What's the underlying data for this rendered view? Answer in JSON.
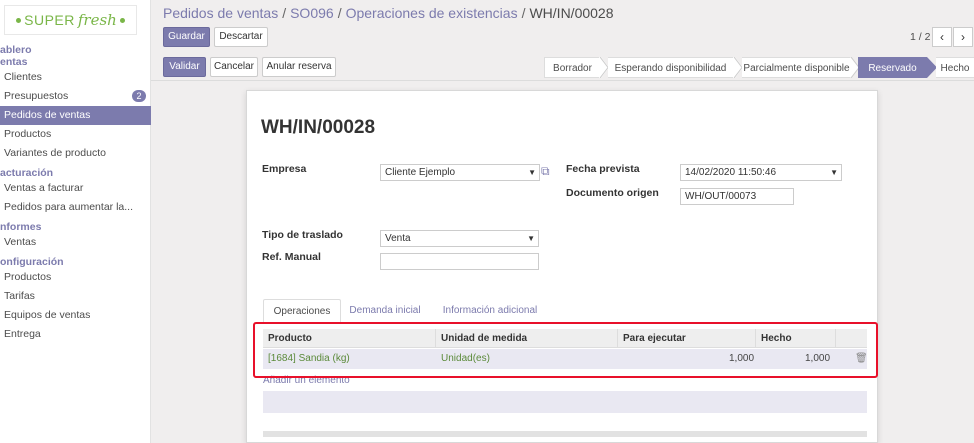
{
  "logo": {
    "super": "SUPER",
    "fresh": "fresh"
  },
  "sidebar": {
    "sections": [
      {
        "title": "ablero",
        "items": []
      },
      {
        "title": "entas",
        "items": [
          {
            "label": "Clientes"
          },
          {
            "label": "Presupuestos",
            "badge": "2"
          },
          {
            "label": "Pedidos de ventas",
            "active": true
          },
          {
            "label": "Productos"
          },
          {
            "label": "Variantes de producto"
          }
        ]
      },
      {
        "title": "acturación",
        "items": [
          {
            "label": "Ventas a facturar"
          },
          {
            "label": "Pedidos para aumentar la..."
          }
        ]
      },
      {
        "title": "nformes",
        "items": [
          {
            "label": "Ventas"
          }
        ]
      },
      {
        "title": "onfiguración",
        "items": [
          {
            "label": "Productos"
          },
          {
            "label": "Tarifas"
          },
          {
            "label": "Equipos de ventas"
          },
          {
            "label": "Entrega"
          }
        ]
      }
    ]
  },
  "breadcrumb": {
    "items": [
      "Pedidos de ventas",
      "SO096",
      "Operaciones de existencias"
    ],
    "current": "WH/IN/00028",
    "separator": "/"
  },
  "toolbar": {
    "save_label": "Guardar",
    "discard_label": "Descartar"
  },
  "pager": {
    "text": "1 / 2",
    "prev_icon": "chevron-left-icon",
    "next_icon": "chevron-right-icon"
  },
  "actions": {
    "validate_label": "Validar",
    "cancel_label": "Cancelar",
    "unreserve_label": "Anular reserva"
  },
  "statusbar": {
    "stages": [
      "Borrador",
      "Esperando disponibilidad",
      "Parcialmente disponible",
      "Reservado",
      "Hecho"
    ],
    "current": "Reservado"
  },
  "form": {
    "title": "WH/IN/00028",
    "empresa_label": "Empresa",
    "empresa_value": "Cliente Ejemplo",
    "fecha_label": "Fecha prevista",
    "fecha_value": "14/02/2020 11:50:46",
    "origen_label": "Documento origen",
    "origen_value": "WH/OUT/00073",
    "tipo_label": "Tipo de traslado",
    "tipo_value": "Venta",
    "ref_label": "Ref. Manual",
    "ref_value": ""
  },
  "tabs": [
    "Operaciones",
    "Demanda inicial",
    "Información adicional"
  ],
  "grid": {
    "columns": [
      "Producto",
      "Unidad de medida",
      "Para ejecutar",
      "Hecho"
    ],
    "rows": [
      {
        "producto": "[1684] Sandia (kg)",
        "unidad": "Unidad(es)",
        "para_ejecutar": "1,000",
        "hecho": "1,000"
      }
    ],
    "add_line": "Añadir un elemento"
  },
  "colors": {
    "brand": "#7c7bad",
    "highlight": "#e8102a",
    "logo": "#7ab648"
  }
}
